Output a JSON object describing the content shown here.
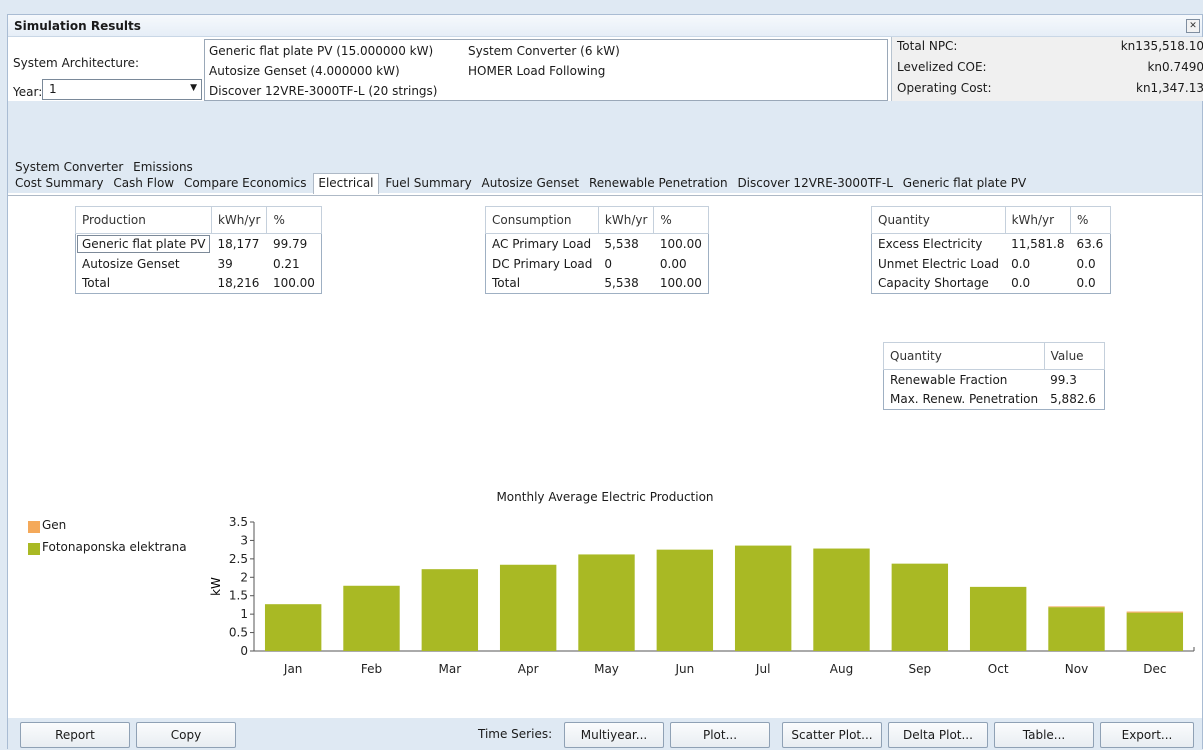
{
  "window": {
    "title": "Simulation Results"
  },
  "architecture": {
    "label": "System Architecture:",
    "year_label": "Year:",
    "year_value": "1",
    "components": [
      "Generic flat plate PV (15.000000 kW)",
      "System Converter (6 kW)",
      "Autosize Genset (4.000000 kW)",
      "HOMER Load Following",
      "Discover 12VRE-3000TF-L (20 strings)"
    ]
  },
  "stats": [
    {
      "label": "Total NPC:",
      "value": "kn135,518.10"
    },
    {
      "label": "Levelized COE:",
      "value": "kn0.7490"
    },
    {
      "label": "Operating Cost:",
      "value": "kn1,347.13"
    }
  ],
  "tabs_row1": [
    "System Converter",
    "Emissions"
  ],
  "tabs_row2": [
    "Cost Summary",
    "Cash Flow",
    "Compare Economics",
    "Electrical",
    "Fuel Summary",
    "Autosize Genset",
    "Renewable Penetration",
    "Discover 12VRE-3000TF-L",
    "Generic flat plate PV"
  ],
  "active_tab": "Electrical",
  "production_table": {
    "headers": [
      "Production",
      "kWh/yr",
      "%"
    ],
    "rows": [
      [
        "Generic flat plate PV",
        "18,177",
        "99.79"
      ],
      [
        "Autosize Genset",
        "39",
        "0.21"
      ],
      [
        "Total",
        "18,216",
        "100.00"
      ]
    ]
  },
  "consumption_table": {
    "headers": [
      "Consumption",
      "kWh/yr",
      "%"
    ],
    "rows": [
      [
        "AC Primary Load",
        "5,538",
        "100.00"
      ],
      [
        "DC Primary Load",
        "0",
        "0.00"
      ],
      [
        "Total",
        "5,538",
        "100.00"
      ]
    ]
  },
  "quantity_table": {
    "headers": [
      "Quantity",
      "kWh/yr",
      "%"
    ],
    "rows": [
      [
        "Excess Electricity",
        "11,581.8",
        "63.6"
      ],
      [
        "Unmet Electric Load",
        "0.0",
        "0.0"
      ],
      [
        "Capacity Shortage",
        "0.0",
        "0.0"
      ]
    ]
  },
  "renewable_table": {
    "headers": [
      "Quantity",
      "Value"
    ],
    "rows": [
      [
        "Renewable Fraction",
        "99.3"
      ],
      [
        "Max. Renew. Penetration",
        "5,882.6"
      ]
    ]
  },
  "chart_data": {
    "type": "bar",
    "title": "Monthly Average Electric Production",
    "xlabel": "",
    "ylabel": "kW",
    "ylim": [
      0,
      3.5
    ],
    "yticks": [
      "0",
      "0.5",
      "1",
      "1.5",
      "2",
      "2.5",
      "3",
      "3.5"
    ],
    "categories": [
      "Jan",
      "Feb",
      "Mar",
      "Apr",
      "May",
      "Jun",
      "Jul",
      "Aug",
      "Sep",
      "Oct",
      "Nov",
      "Dec"
    ],
    "stacked": true,
    "series": [
      {
        "name": "Fotonaponska elektrana",
        "color": "#a9b924",
        "values": [
          1.27,
          1.77,
          2.22,
          2.34,
          2.62,
          2.75,
          2.86,
          2.78,
          2.37,
          1.74,
          1.19,
          1.04
        ]
      },
      {
        "name": "Gen",
        "color": "#f4a95a",
        "values": [
          0,
          0,
          0,
          0,
          0,
          0,
          0,
          0,
          0,
          0,
          0.02,
          0.03
        ]
      }
    ],
    "legend_position": "left",
    "grid": false
  },
  "buttons": {
    "report": "Report",
    "copy": "Copy",
    "time_series_label": "Time Series:",
    "multiyear": "Multiyear...",
    "plot": "Plot...",
    "scatter": "Scatter Plot...",
    "delta": "Delta Plot...",
    "table": "Table...",
    "export": "Export..."
  }
}
